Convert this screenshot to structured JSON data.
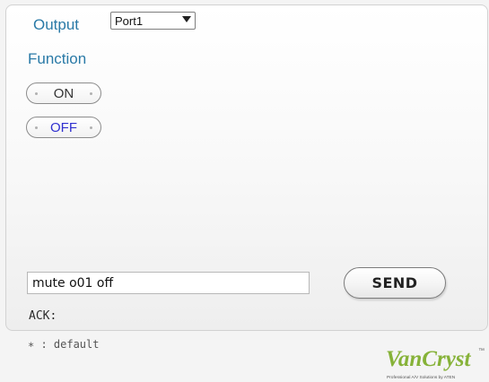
{
  "output": {
    "label": "Output",
    "selected": "Port1"
  },
  "function": {
    "label": "Function",
    "buttons": [
      {
        "label": "ON"
      },
      {
        "label": "OFF"
      }
    ]
  },
  "command": {
    "value": "mute o01 off"
  },
  "send_button": {
    "label": "SEND"
  },
  "ack": {
    "label": "ACK:"
  },
  "footnote": {
    "text": "∗ : default"
  },
  "logo": {
    "brand": "VanCryst",
    "trademark": "™",
    "tagline": "Professional A/V Solutions by ATEN"
  },
  "colors": {
    "label_blue": "#2a7aa7",
    "off_text_blue": "#3030d0",
    "logo_green": "#86b238"
  }
}
